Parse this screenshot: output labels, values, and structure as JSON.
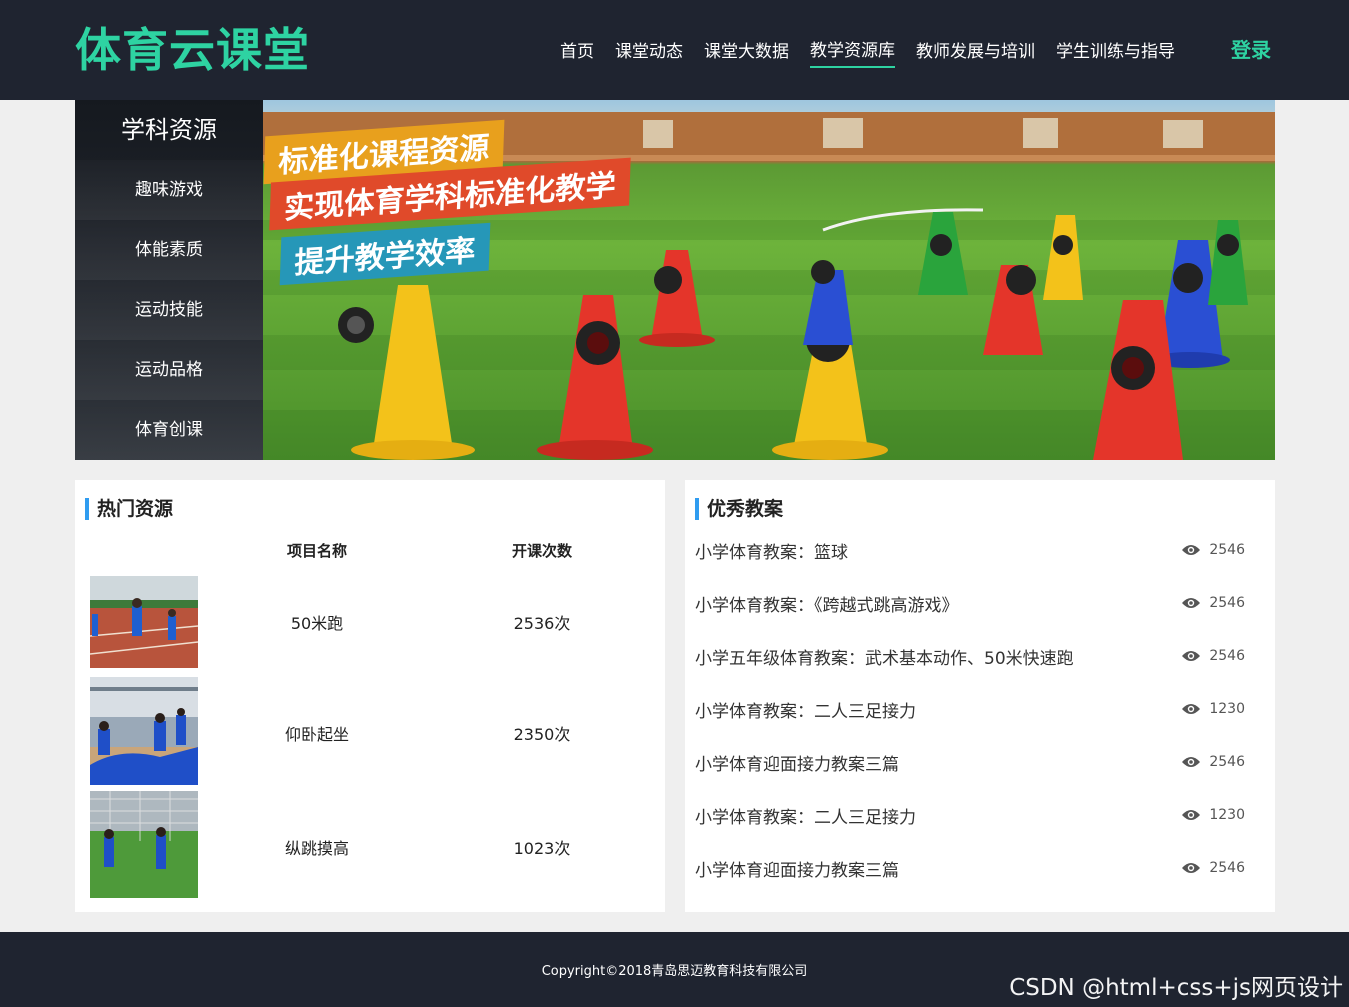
{
  "header": {
    "logo": "体育云课堂",
    "nav": [
      {
        "label": "首页"
      },
      {
        "label": "课堂动态"
      },
      {
        "label": "课堂大数据"
      },
      {
        "label": "教学资源库",
        "active": true
      },
      {
        "label": "教师发展与培训"
      },
      {
        "label": "学生训练与指导"
      }
    ],
    "login": "登录",
    "accent_color": "#2ed3a2"
  },
  "sidebar": {
    "title": "学科资源",
    "items": [
      {
        "label": "趣味游戏"
      },
      {
        "label": "体能素质"
      },
      {
        "label": "运动技能"
      },
      {
        "label": "运动品格"
      },
      {
        "label": "体育创课"
      }
    ]
  },
  "banner": {
    "slogans": [
      "标准化课程资源",
      "实现体育学科标准化教学",
      "提升教学效率"
    ]
  },
  "hot_resources": {
    "title": "热门资源",
    "col_name": "项目名称",
    "col_count": "开课次数",
    "rows": [
      {
        "name": "50米跑",
        "count": "2536次"
      },
      {
        "name": "仰卧起坐",
        "count": "2350次"
      },
      {
        "name": "纵跳摸高",
        "count": "1023次"
      }
    ]
  },
  "lesson_plans": {
    "title": "优秀教案",
    "items": [
      {
        "title": "小学体育教案：篮球",
        "views": "2546"
      },
      {
        "title": "小学体育教案：《跨越式跳高游戏》",
        "views": "2546"
      },
      {
        "title": "小学五年级体育教案：武术基本动作、50米快速跑",
        "views": "2546"
      },
      {
        "title": "小学体育教案：二人三足接力",
        "views": "1230"
      },
      {
        "title": "小学体育迎面接力教案三篇",
        "views": "2546"
      },
      {
        "title": "小学体育教案：二人三足接力",
        "views": "1230"
      },
      {
        "title": "小学体育迎面接力教案三篇",
        "views": "2546"
      }
    ]
  },
  "footer": {
    "copyright": "Copyright©2018青岛思迈教育科技有限公司",
    "watermark": "CSDN @html+css+js网页设计"
  }
}
